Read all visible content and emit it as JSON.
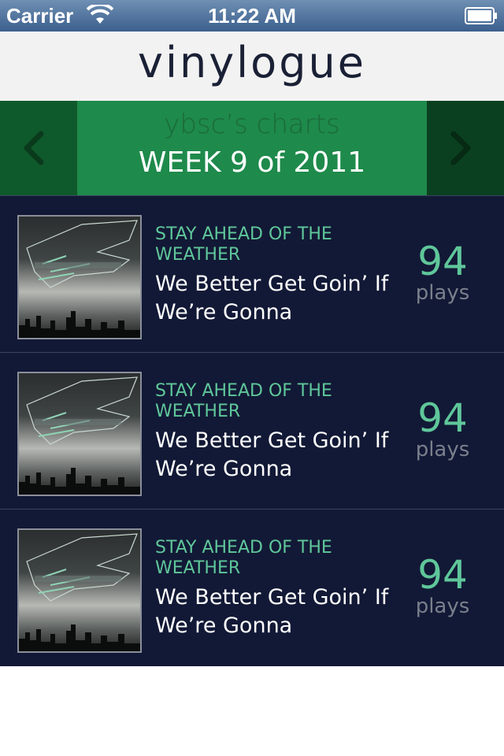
{
  "status_bar": {
    "carrier": "Carrier",
    "time": "11:22 AM",
    "wifi_icon": "wifi-icon",
    "battery_icon": "battery-icon"
  },
  "header": {
    "title": "vinylogue"
  },
  "week_nav": {
    "user_charts": "ybsc’s charts",
    "week_label": "WEEK 9 of 2011",
    "prev_icon": "chevron-left-icon",
    "next_icon": "chevron-right-icon"
  },
  "charts": [
    {
      "artist": "STAY AHEAD OF THE WEATHER",
      "track": "We Better Get Goin’ If We’re Gonna",
      "plays": "94",
      "plays_label": "plays"
    },
    {
      "artist": "STAY AHEAD OF THE WEATHER",
      "track": "We Better Get Goin’ If We’re Gonna",
      "plays": "94",
      "plays_label": "plays"
    },
    {
      "artist": "STAY AHEAD OF THE WEATHER",
      "track": "We Better Get Goin’ If We’re Gonna",
      "plays": "94",
      "plays_label": "plays"
    }
  ],
  "colors": {
    "status_bar": "#3b5f8d",
    "header_bg": "#f2f2f2",
    "week_center": "#1e8a4b",
    "week_sides": "#0d4a25",
    "list_bg": "#121936",
    "accent": "#5fc79a"
  }
}
